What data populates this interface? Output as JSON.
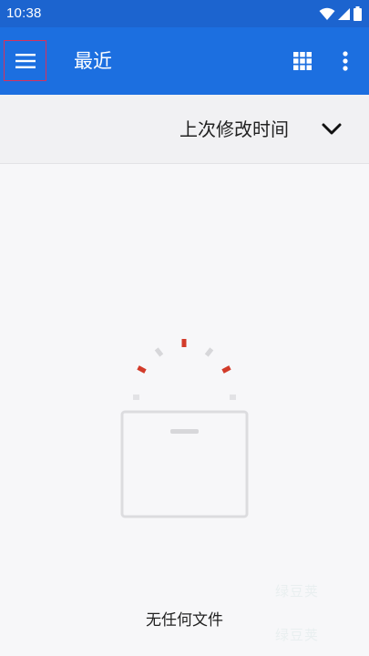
{
  "status_bar": {
    "time": "10:38",
    "icons": [
      "wifi-icon",
      "cell-signal-icon",
      "battery-icon"
    ]
  },
  "app_bar": {
    "menu_icon": "hamburger-menu-icon",
    "title": "最近",
    "grid_icon": "grid-view-icon",
    "more_icon": "more-vert-icon"
  },
  "sort_bar": {
    "label": "上次修改时间",
    "chevron_icon": "chevron-down-icon"
  },
  "empty_state": {
    "icon": "empty-box-icon",
    "message": "无任何文件"
  },
  "watermarks": [
    "绿豆荚",
    "绿豆荚"
  ],
  "colors": {
    "status_bar": "#1c64cf",
    "app_bar": "#1c6fe0",
    "background": "#f7f7f9",
    "sort_bar": "#f1f1f3",
    "accent_red": "#d23b2a",
    "menu_highlight": "#d8315b"
  }
}
